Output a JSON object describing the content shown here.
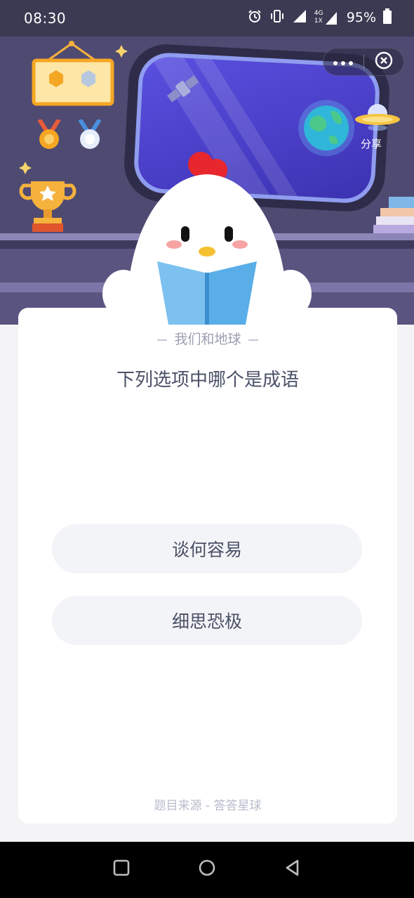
{
  "status_bar": {
    "time": "08:30",
    "network_top": "4G",
    "network_bottom": "1X",
    "battery": "95%"
  },
  "header": {
    "more_icon": "more-dots-icon",
    "close_icon": "close-circle-icon",
    "share_label": "分享"
  },
  "quiz": {
    "category": "我们和地球",
    "question": "下列选项中哪个是成语",
    "options": [
      {
        "label": "谈何容易"
      },
      {
        "label": "细思恐极"
      }
    ],
    "source": "题目来源 - 答答星球"
  },
  "nav": {
    "recents_icon": "square-icon",
    "home_icon": "circle-icon",
    "back_icon": "triangle-back-icon"
  },
  "colors": {
    "scene_bg": "#4f4a72",
    "window_glass": "#4a3fc8",
    "card_bg": "#ffffff",
    "option_bg": "#f3f4f7",
    "text_main": "#4a5067",
    "text_muted": "#9b9fb2"
  }
}
